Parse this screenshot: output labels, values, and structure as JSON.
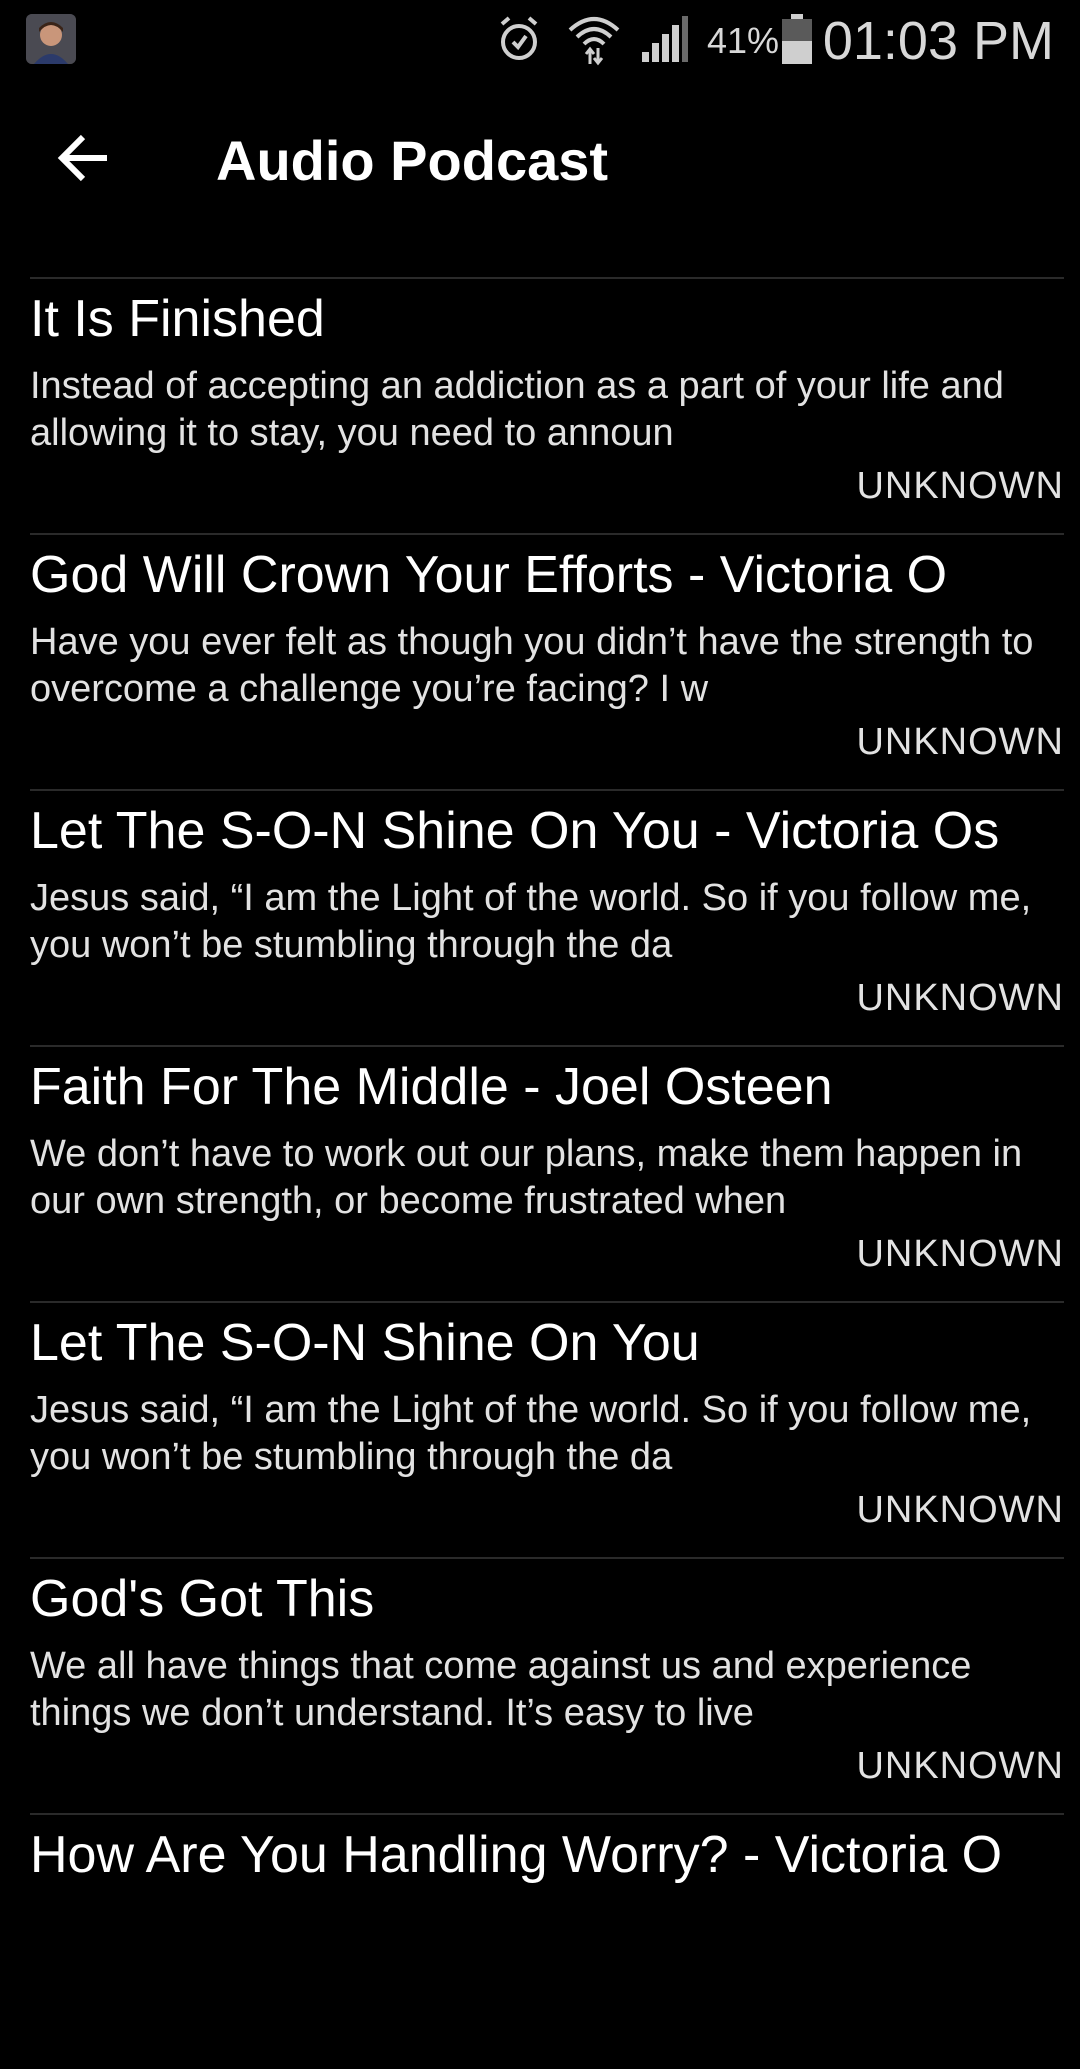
{
  "status_bar": {
    "battery_percent": "41%",
    "time": "01:03 PM",
    "icons": [
      "avatar",
      "alarm-icon",
      "wifi-icon",
      "signal-icon",
      "battery-icon"
    ]
  },
  "app_bar": {
    "title": "Audio Podcast",
    "back_icon": "arrow-left-icon"
  },
  "episodes": [
    {
      "title": "It Is Finished",
      "description": "Instead of accepting an addiction as a part of your life and allowing it to stay, you need to announ",
      "author": "UNKNOWN"
    },
    {
      "title": "God Will Crown Your Efforts - Victoria O",
      "description": "Have you ever felt as though you didn’t have the strength to overcome a challenge you’re facing? I w",
      "author": "UNKNOWN"
    },
    {
      "title": "Let The S-O-N Shine On You - Victoria Os",
      "description": "Jesus said, “I am the Light of the world. So if you follow me, you won’t be stumbling through the da",
      "author": "UNKNOWN"
    },
    {
      "title": "Faith For The Middle - Joel Osteen",
      "description": "We don’t have to work out our plans, make them happen in our own strength, or become frustrated when",
      "author": "UNKNOWN"
    },
    {
      "title": "Let The S-O-N Shine On You",
      "description": "Jesus said, “I am the Light of the world. So if you follow me, you won’t be stumbling through the da",
      "author": "UNKNOWN"
    },
    {
      "title": "God's Got This",
      "description": "We all have things that come against us and experience things we don’t understand. It’s easy to live",
      "author": "UNKNOWN"
    },
    {
      "title": "How Are You Handling Worry? - Victoria O",
      "description": "",
      "author": ""
    }
  ],
  "colors": {
    "background": "#000000",
    "text_primary": "#ffffff",
    "text_secondary": "#e2e2e2",
    "divider": "#2a2a2a"
  }
}
